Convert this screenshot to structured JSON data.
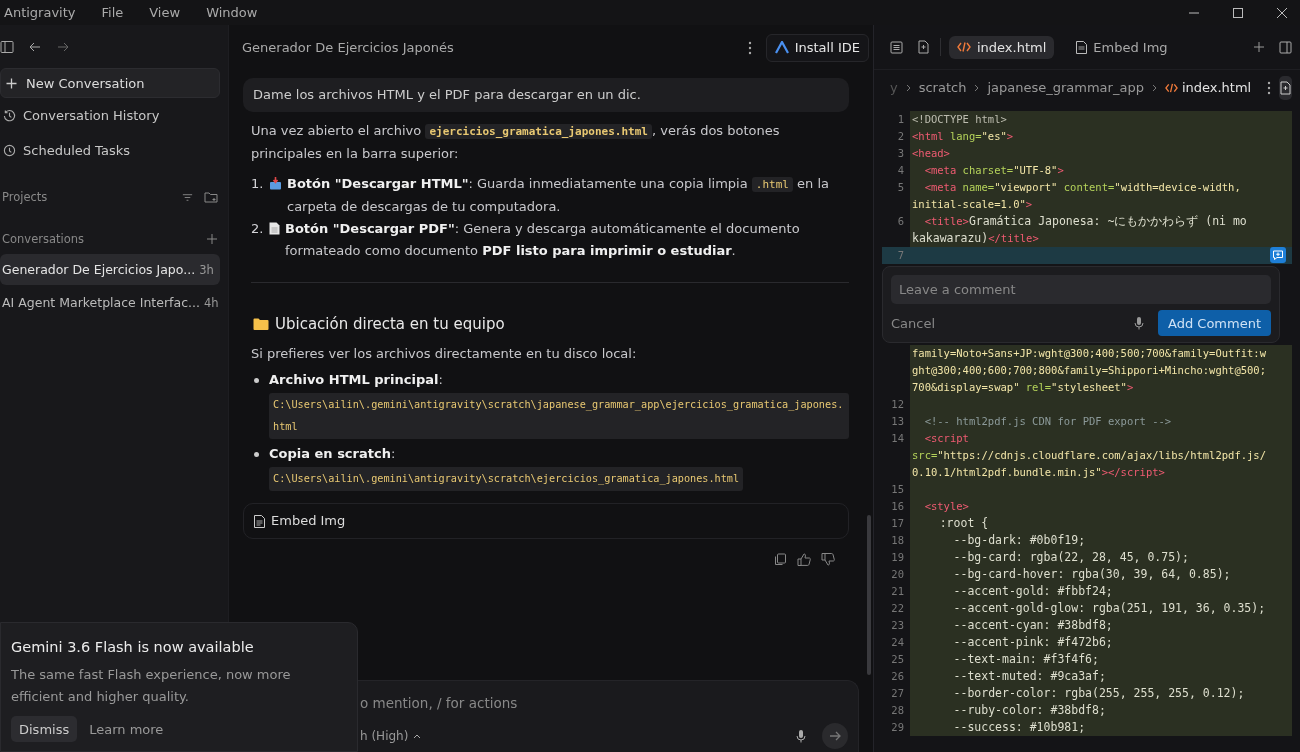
{
  "menu": {
    "app": "Antigravity",
    "items": [
      "File",
      "View",
      "Window"
    ]
  },
  "sidebar": {
    "new_button": "New Conversation",
    "nav": [
      {
        "kind": "history",
        "label": "Conversation History"
      },
      {
        "kind": "clock",
        "label": "Scheduled Tasks"
      }
    ],
    "projects_title": "Projects",
    "conversations_title": "Conversations",
    "conversations": [
      {
        "title": "Generador De Ejercicios Japo...",
        "time": "3h",
        "selected": true
      },
      {
        "title": "AI Agent Marketplace Interfac...",
        "time": "4h",
        "selected": false
      }
    ]
  },
  "toast": {
    "title": "Gemini 3.6 Flash is now available",
    "body": "The same fast Flash experience, now more efficient and higher quality.",
    "dismiss": "Dismiss",
    "learn_more": "Learn more"
  },
  "chat": {
    "title": "Generador De Ejercicios Japonés",
    "install_button": "Install IDE",
    "user_message": "Dame los archivos HTML y el PDF para descargar en un dic.",
    "intro": [
      {
        "kind": "text",
        "t": "Una vez abierto el archivo "
      },
      {
        "kind": "code",
        "t": "ejercicios_gramatica_japones.html"
      },
      {
        "kind": "text",
        "t": ", verás dos botones principales en la barra superior:"
      }
    ],
    "steps": [
      {
        "num": "1.",
        "parts": [
          {
            "kind": "bold",
            "t": "Botón \"Descargar HTML\""
          },
          {
            "kind": "text",
            "t": ": Guarda inmediatamente una copia limpia "
          },
          {
            "kind": "code",
            "t": ".html"
          },
          {
            "kind": "text",
            "t": " en la carpeta de descargas de tu computadora."
          }
        ]
      },
      {
        "num": "2.",
        "parts": [
          {
            "kind": "bold",
            "t": "Botón \"Descargar PDF\""
          },
          {
            "kind": "text",
            "t": ": Genera y descarga automáticamente el documento formateado como documento "
          },
          {
            "kind": "bold",
            "t": "PDF listo para imprimir o estudiar"
          },
          {
            "kind": "text",
            "t": "."
          }
        ]
      }
    ],
    "heading": "Ubicación directa en tu equipo",
    "paragraph": "Si prefieres ver los archivos directamente en tu disco local:",
    "locations": [
      {
        "label": "**Archivo HTML principal**:",
        "path": "C:\\Users\\ailin\\.gemini\\antigravity\\scratch\\japanese_grammar_app\\ejercicios_gramatica_japones.html"
      },
      {
        "label": "**Copia en scratch**:",
        "path": "C:\\Users\\ailin\\.gemini\\antigravity\\scratch\\ejercicios_gramatica_japones.html"
      }
    ],
    "attachment": "Embed Img",
    "input_placeholder": "o mention, / for actions",
    "model": "h (High)"
  },
  "editor": {
    "tabs": [
      {
        "kind": "code",
        "label": "index.html",
        "selected": true
      },
      {
        "kind": "doc",
        "label": "Embed Img",
        "selected": false
      }
    ],
    "breadcrumb": [
      "y",
      "scratch",
      "japanese_grammar_app",
      "index.html"
    ],
    "lines": [
      {
        "num": "1",
        "selected": false,
        "parts": [
          {
            "kind": "doc",
            "t": "<!DOCTYPE html>"
          }
        ]
      },
      {
        "num": "2",
        "selected": false,
        "parts": [
          {
            "kind": "tag",
            "t": "<html"
          },
          {
            "kind": "attr",
            "t": " lang="
          },
          {
            "kind": "str",
            "t": "\"es\""
          },
          {
            "kind": "tag",
            "t": ">"
          }
        ]
      },
      {
        "num": "3",
        "selected": false,
        "parts": [
          {
            "kind": "tag",
            "t": "<head>"
          }
        ]
      },
      {
        "num": "4",
        "selected": false,
        "parts": [
          {
            "kind": "tag",
            "t": "  <meta"
          },
          {
            "kind": "attr",
            "t": " charset="
          },
          {
            "kind": "str",
            "t": "\"UTF-8\""
          },
          {
            "kind": "tag",
            "t": ">"
          }
        ]
      },
      {
        "num": "5",
        "selected": false,
        "parts": [
          {
            "kind": "tag",
            "t": "  <meta"
          },
          {
            "kind": "attr",
            "t": " name="
          },
          {
            "kind": "str",
            "t": "\"viewport\""
          },
          {
            "kind": "attr",
            "t": " content="
          },
          {
            "kind": "str",
            "t": "\"width=device-width,"
          }
        ]
      },
      {
        "selected": false,
        "parts": [
          {
            "kind": "str",
            "t": "initial-scale=1.0\""
          },
          {
            "kind": "tag",
            "t": ">"
          }
        ]
      },
      {
        "num": "6",
        "selected": false,
        "parts": [
          {
            "kind": "tag",
            "t": "  <title>"
          },
          {
            "kind": "text",
            "t": "Gramática Japonesa: ~にもかかわらず (ni mo"
          }
        ]
      },
      {
        "selected": false,
        "parts": [
          {
            "kind": "text",
            "t": "kakawarazu)"
          },
          {
            "kind": "tag",
            "t": "</title>"
          }
        ]
      },
      {
        "num": "7",
        "selected": true
      }
    ],
    "comment_box": {
      "placeholder": "Leave a comment",
      "cancel": "Cancel",
      "submit": "Add Comment"
    },
    "more_lines": [
      {
        "selected": false,
        "parts": [
          {
            "kind": "str",
            "t": "family=Noto+Sans+JP:wght@300;400;500;700&family=Outfit:w"
          }
        ]
      },
      {
        "selected": false,
        "parts": [
          {
            "kind": "str",
            "t": "ght@300;400;600;700;800&family=Shippori+Mincho:wght@500;"
          }
        ]
      },
      {
        "selected": false,
        "parts": [
          {
            "kind": "str",
            "t": "700&display=swap\""
          },
          {
            "kind": "attr",
            "t": " rel="
          },
          {
            "kind": "str",
            "t": "\"stylesheet\""
          },
          {
            "kind": "tag",
            "t": ">"
          }
        ]
      },
      {
        "num": "12",
        "selected": false
      },
      {
        "num": "13",
        "selected": false,
        "parts": [
          {
            "kind": "com",
            "t": "  <!-- html2pdf.js CDN for PDF export -->"
          }
        ]
      },
      {
        "num": "14",
        "selected": false,
        "parts": [
          {
            "kind": "tag",
            "t": "  <script"
          }
        ]
      },
      {
        "selected": false,
        "parts": [
          {
            "kind": "attr",
            "t": "src="
          },
          {
            "kind": "str",
            "t": "\"https://cdnjs.cloudflare.com/ajax/libs/html2pdf.js/"
          }
        ]
      },
      {
        "selected": false,
        "parts": [
          {
            "kind": "str",
            "t": "0.10.1/html2pdf.bundle.min.js\""
          },
          {
            "kind": "tag",
            "t": "></script>"
          }
        ]
      },
      {
        "num": "15",
        "selected": false
      },
      {
        "num": "16",
        "selected": false,
        "parts": [
          {
            "kind": "tag",
            "t": "  <style>"
          }
        ]
      },
      {
        "num": "17",
        "selected": false,
        "parts": [
          {
            "kind": "text",
            "t": "    :root {"
          }
        ]
      },
      {
        "num": "18",
        "selected": false,
        "parts": [
          {
            "kind": "text",
            "t": "      --bg-dark: #0b0f19;"
          }
        ]
      },
      {
        "num": "19",
        "selected": false,
        "parts": [
          {
            "kind": "text",
            "t": "      --bg-card: rgba(22, 28, 45, 0.75);"
          }
        ]
      },
      {
        "num": "20",
        "selected": false,
        "parts": [
          {
            "kind": "text",
            "t": "      --bg-card-hover: rgba(30, 39, 64, 0.85);"
          }
        ]
      },
      {
        "num": "21",
        "selected": false,
        "parts": [
          {
            "kind": "text",
            "t": "      --accent-gold: #fbbf24;"
          }
        ]
      },
      {
        "num": "22",
        "selected": false,
        "parts": [
          {
            "kind": "text",
            "t": "      --accent-gold-glow: rgba(251, 191, 36, 0.35);"
          }
        ]
      },
      {
        "num": "23",
        "selected": false,
        "parts": [
          {
            "kind": "text",
            "t": "      --accent-cyan: #38bdf8;"
          }
        ]
      },
      {
        "num": "24",
        "selected": false,
        "parts": [
          {
            "kind": "text",
            "t": "      --accent-pink: #f472b6;"
          }
        ]
      },
      {
        "num": "25",
        "selected": false,
        "parts": [
          {
            "kind": "text",
            "t": "      --text-main: #f3f4f6;"
          }
        ]
      },
      {
        "num": "26",
        "selected": false,
        "parts": [
          {
            "kind": "text",
            "t": "      --text-muted: #9ca3af;"
          }
        ]
      },
      {
        "num": "27",
        "selected": false,
        "parts": [
          {
            "kind": "text",
            "t": "      --border-color: rgba(255, 255, 255, 0.12);"
          }
        ]
      },
      {
        "num": "28",
        "selected": false,
        "parts": [
          {
            "kind": "text",
            "t": "      --ruby-color: #38bdf8;"
          }
        ]
      },
      {
        "num": "29",
        "selected": false,
        "parts": [
          {
            "kind": "text",
            "t": "      --success: #10b981;"
          }
        ]
      }
    ]
  }
}
